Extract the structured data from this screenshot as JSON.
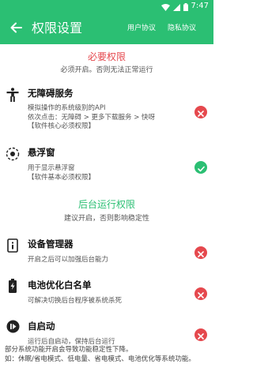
{
  "status_bar": {
    "time": "7:47"
  },
  "header": {
    "title": "权限设置",
    "user_agreement": "用户协议",
    "privacy_policy": "隐私协议"
  },
  "required": {
    "title": "必要权限",
    "subtitle": "必须开启。否则无法正常运行",
    "items": [
      {
        "name": "无障碍服务",
        "desc": "模拟操作的系统级别的API\n依次点击：无障碍 > 更多下载服务 > 快呀\n【软件核心必须权限】",
        "status": "off",
        "icon": "accessibility-icon"
      },
      {
        "name": "悬浮窗",
        "desc": "用于显示悬浮窗\n【软件基本必须权限】",
        "status": "on",
        "icon": "floating-window-icon"
      }
    ]
  },
  "background": {
    "title": "后台运行权限",
    "subtitle": "建议开启，否则影响稳定性",
    "items": [
      {
        "name": "设备管理器",
        "desc": "开启之后可以加强后台能力",
        "status": "off",
        "icon": "device-manager-icon"
      },
      {
        "name": "电池优化白名单",
        "desc": "可解决切换后台程序被系统杀死",
        "status": "off",
        "icon": "battery-icon"
      },
      {
        "name": "自启动",
        "desc": "运行后自启动，保持后台运行",
        "status": "off",
        "icon": "autostart-icon"
      }
    ]
  },
  "footer": {
    "note": "部分系统功能开启会导致功能稳定性下降。\n如：休眠/省电模式、低电量、省电模式、电池优化等系统功能。"
  },
  "colors": {
    "accent": "#2bbf73",
    "required_title": "#e5484d",
    "status_off": "#e5484d",
    "status_on": "#2bbf73"
  }
}
